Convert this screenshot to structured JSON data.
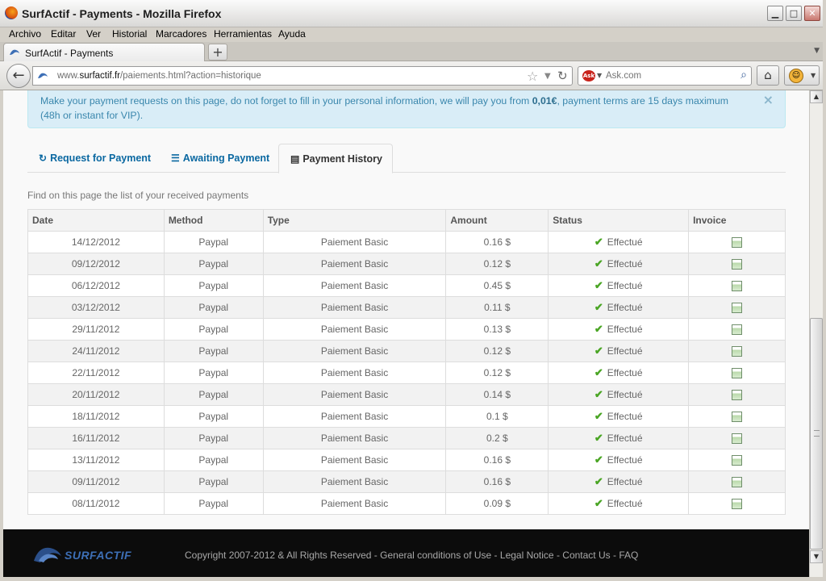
{
  "window": {
    "title": "SurfActif - Payments - Mozilla Firefox",
    "minimize_glyph": "▁",
    "maximize_glyph": "□",
    "close_glyph": "✕"
  },
  "menu": [
    "Archivo",
    "Editar",
    "Ver",
    "Historial",
    "Marcadores",
    "Herramientas",
    "Ayuda"
  ],
  "browser_tab": {
    "label": "SurfActif - Payments",
    "new_tab_glyph": "+"
  },
  "navbar": {
    "url_prefix": "www.",
    "url_domain": "surfactif.fr",
    "url_path": "/paiements.html?action=historique",
    "search_placeholder": "Ask.com",
    "search_engine_glyph": "Ask"
  },
  "alert": {
    "text_before": "Make your payment requests on this page, do not forget to fill in your personal information, we will pay you from ",
    "amount": "0,01€",
    "text_after": ", payment terms are 15 days maximum (48h or instant for VIP).",
    "close_glyph": "×"
  },
  "tabs": [
    {
      "label": "Request for Payment",
      "icon": "refresh-icon",
      "glyph": "↻"
    },
    {
      "label": "Awaiting Payment",
      "icon": "list-icon",
      "glyph": "☰"
    },
    {
      "label": "Payment History",
      "icon": "folder-open-icon",
      "glyph": "▤"
    }
  ],
  "intro": "Find on this page the list of your received payments",
  "table": {
    "headers": [
      "Date",
      "Method",
      "Type",
      "Amount",
      "Status",
      "Invoice"
    ],
    "rows": [
      {
        "date": "14/12/2012",
        "method": "Paypal",
        "type": "Paiement Basic",
        "amount": "0.16 $",
        "status": "Effectué"
      },
      {
        "date": "09/12/2012",
        "method": "Paypal",
        "type": "Paiement Basic",
        "amount": "0.12 $",
        "status": "Effectué"
      },
      {
        "date": "06/12/2012",
        "method": "Paypal",
        "type": "Paiement Basic",
        "amount": "0.45 $",
        "status": "Effectué"
      },
      {
        "date": "03/12/2012",
        "method": "Paypal",
        "type": "Paiement Basic",
        "amount": "0.11 $",
        "status": "Effectué"
      },
      {
        "date": "29/11/2012",
        "method": "Paypal",
        "type": "Paiement Basic",
        "amount": "0.13 $",
        "status": "Effectué"
      },
      {
        "date": "24/11/2012",
        "method": "Paypal",
        "type": "Paiement Basic",
        "amount": "0.12 $",
        "status": "Effectué"
      },
      {
        "date": "22/11/2012",
        "method": "Paypal",
        "type": "Paiement Basic",
        "amount": "0.12 $",
        "status": "Effectué"
      },
      {
        "date": "20/11/2012",
        "method": "Paypal",
        "type": "Paiement Basic",
        "amount": "0.14 $",
        "status": "Effectué"
      },
      {
        "date": "18/11/2012",
        "method": "Paypal",
        "type": "Paiement Basic",
        "amount": "0.1 $",
        "status": "Effectué"
      },
      {
        "date": "16/11/2012",
        "method": "Paypal",
        "type": "Paiement Basic",
        "amount": "0.2 $",
        "status": "Effectué"
      },
      {
        "date": "13/11/2012",
        "method": "Paypal",
        "type": "Paiement Basic",
        "amount": "0.16 $",
        "status": "Effectué"
      },
      {
        "date": "09/11/2012",
        "method": "Paypal",
        "type": "Paiement Basic",
        "amount": "0.16 $",
        "status": "Effectué"
      },
      {
        "date": "08/11/2012",
        "method": "Paypal",
        "type": "Paiement Basic",
        "amount": "0.09 $",
        "status": "Effectué"
      }
    ]
  },
  "footer": {
    "logo": "SURFACTIF",
    "copyright": "Copyright 2007-2012 & All Rights Reserved - ",
    "links": [
      "General conditions of Use",
      "Legal Notice",
      "Contact Us",
      "FAQ"
    ],
    "separator": " - "
  },
  "colors": {
    "link": "#0a68a1",
    "alert_bg": "#d9edf7",
    "alert_text": "#3a87ad",
    "status_ok": "#4aa524",
    "footer_bg": "#0c0c0c"
  }
}
